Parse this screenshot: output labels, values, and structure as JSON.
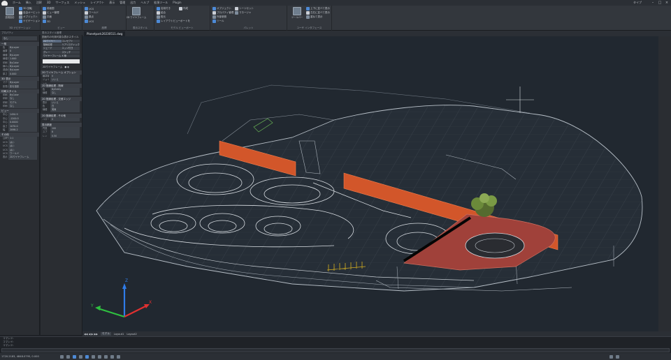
{
  "menubar": {
    "items": [
      "ホーム",
      "挿入",
      "注釈",
      "3D",
      "サーフェス",
      "メッシュ",
      "レイアウト",
      "表示",
      "管理",
      "出力",
      "ヘルプ",
      "拡張ツール",
      "Plugin"
    ],
    "title": "タイプ"
  },
  "ribbon": {
    "groups": [
      {
        "label": "3D ナビゲーション",
        "lines": [
          "3D 回転",
          "自由オービット",
          "オブジェクト",
          "ナビゲーション"
        ],
        "big": "透視投影"
      },
      {
        "label": "ビュー",
        "lines": [
          "前面図",
          "ビュー管理",
          "平面",
          "3D"
        ]
      },
      {
        "label": "座標",
        "lines": [
          "UCS",
          "ワールド",
          "原点",
          "UCS"
        ]
      },
      {
        "label": "表示スタイル",
        "big": "2D ワイヤフレーム"
      },
      {
        "label": "モデル ビューポート",
        "lines": [
          "名前付き",
          "結合",
          "復元",
          "レイアウトビューポートを",
          "作成"
        ]
      },
      {
        "label": "パレット",
        "lines": [
          "オブジェクト",
          "プロパティ管理",
          "外部参照",
          "ツール",
          "シートセット",
          "マネージャ"
        ]
      },
      {
        "label": "ユーザ インタフェース",
        "lines": [
          "上下に並べて表示",
          "左右に並べて表示",
          "重ねて表示"
        ],
        "big": "ツールバー"
      }
    ]
  },
  "panels": {
    "props_header": "プロパティ",
    "vstyle_header": "表示スタイル管理"
  },
  "properties": {
    "selection": "なし",
    "sections": [
      {
        "title": "一般",
        "rows": [
          [
            "色",
            "ByLayer"
          ],
          [
            "画層",
            "0"
          ],
          [
            "線種",
            "ByLayer"
          ],
          [
            "線種尺度",
            "1.000"
          ],
          [
            "印刷",
            "ByColor"
          ],
          [
            "線の太さ",
            "ByLayer"
          ],
          [
            "透過性",
            "ByLayer"
          ],
          [
            "厚さ",
            "0.000"
          ]
        ]
      },
      {
        "title": "3D 表示",
        "rows": [
          [
            "マテリアル",
            "ByLayer"
          ],
          [
            "影表示",
            "影を投影"
          ]
        ]
      },
      {
        "title": "印刷スタイル",
        "rows": [
          [
            "印刷",
            "ByColor"
          ],
          [
            "印刷",
            "なし"
          ],
          [
            "印刷",
            "モデル"
          ],
          [
            "印刷",
            "なし"
          ]
        ]
      },
      {
        "title": "ビュー",
        "rows": [
          [
            "中心 X",
            "1450.9"
          ],
          [
            "中心 Y",
            "-1200.5"
          ],
          [
            "中心 Z",
            "0.0000"
          ],
          [
            "高さ",
            "1070.0"
          ],
          [
            "幅",
            "2098.2"
          ]
        ]
      },
      {
        "title": "その他",
        "rows": [
          [
            "注釈尺",
            "1:1"
          ],
          [
            "UCS",
            "はい"
          ],
          [
            "UCS",
            "はい"
          ],
          [
            "UCS",
            "はい"
          ],
          [
            "UCS",
            "ワールド"
          ],
          [
            "表示",
            "2Dワイヤフレーム"
          ]
        ]
      }
    ]
  },
  "visual_style": {
    "title": "図面内の利用可能な表示スタイル",
    "styles": [
      "2Dワイヤー",
      "コンセプト",
      "隠線処理",
      "リアリスティック",
      "シェード",
      "エッジ付き",
      "グレー",
      "スケッチ",
      "ワイヤーフレーム",
      "X 線"
    ],
    "selected": "2Dワイヤフレーム",
    "sections": [
      {
        "title": "2D ワイヤフレーム オプション",
        "rows": [
          [
            "輪郭線",
            "0"
          ],
          [
            "ジョイント",
            "いいえ"
          ]
        ]
      },
      {
        "title": "2D 陰線処理 - 陰線",
        "rows": [
          [
            "色",
            "ByEntity"
          ],
          [
            "線種",
            "なし"
          ]
        ]
      },
      {
        "title": "2D 陰線処理 - 交差エッジ",
        "rows": [
          [
            "表示",
            "いいえ"
          ],
          [
            "色",
            "白"
          ],
          [
            "線種",
            "実線"
          ]
        ]
      },
      {
        "title": "2D 陰線処理 - その他",
        "rows": [
          [
            "ハロー",
            "0"
          ]
        ]
      },
      {
        "title": "表示精度",
        "rows": [
          [
            "円弧",
            "100"
          ],
          [
            "スプ",
            "8"
          ],
          [
            "レン",
            "0.50"
          ]
        ]
      }
    ]
  },
  "document": {
    "tab": "Planetpark20230511.dwg",
    "layout_tabs": [
      "モデル",
      "Layout1",
      "Layout2"
    ]
  },
  "command": {
    "lines": [
      "コマンド:",
      "コマンド:",
      "コマンド:"
    ],
    "placeholder": ""
  },
  "statusbar": {
    "coords": "1720.2183, 4848.0795, 0.000"
  },
  "colors": {
    "wall_orange": "#d2562a",
    "deck_red": "#a0413a",
    "tree_green": "#556b2f",
    "axis_x": "#e03030",
    "axis_y": "#2fc040",
    "axis_z": "#2f7ce8"
  }
}
